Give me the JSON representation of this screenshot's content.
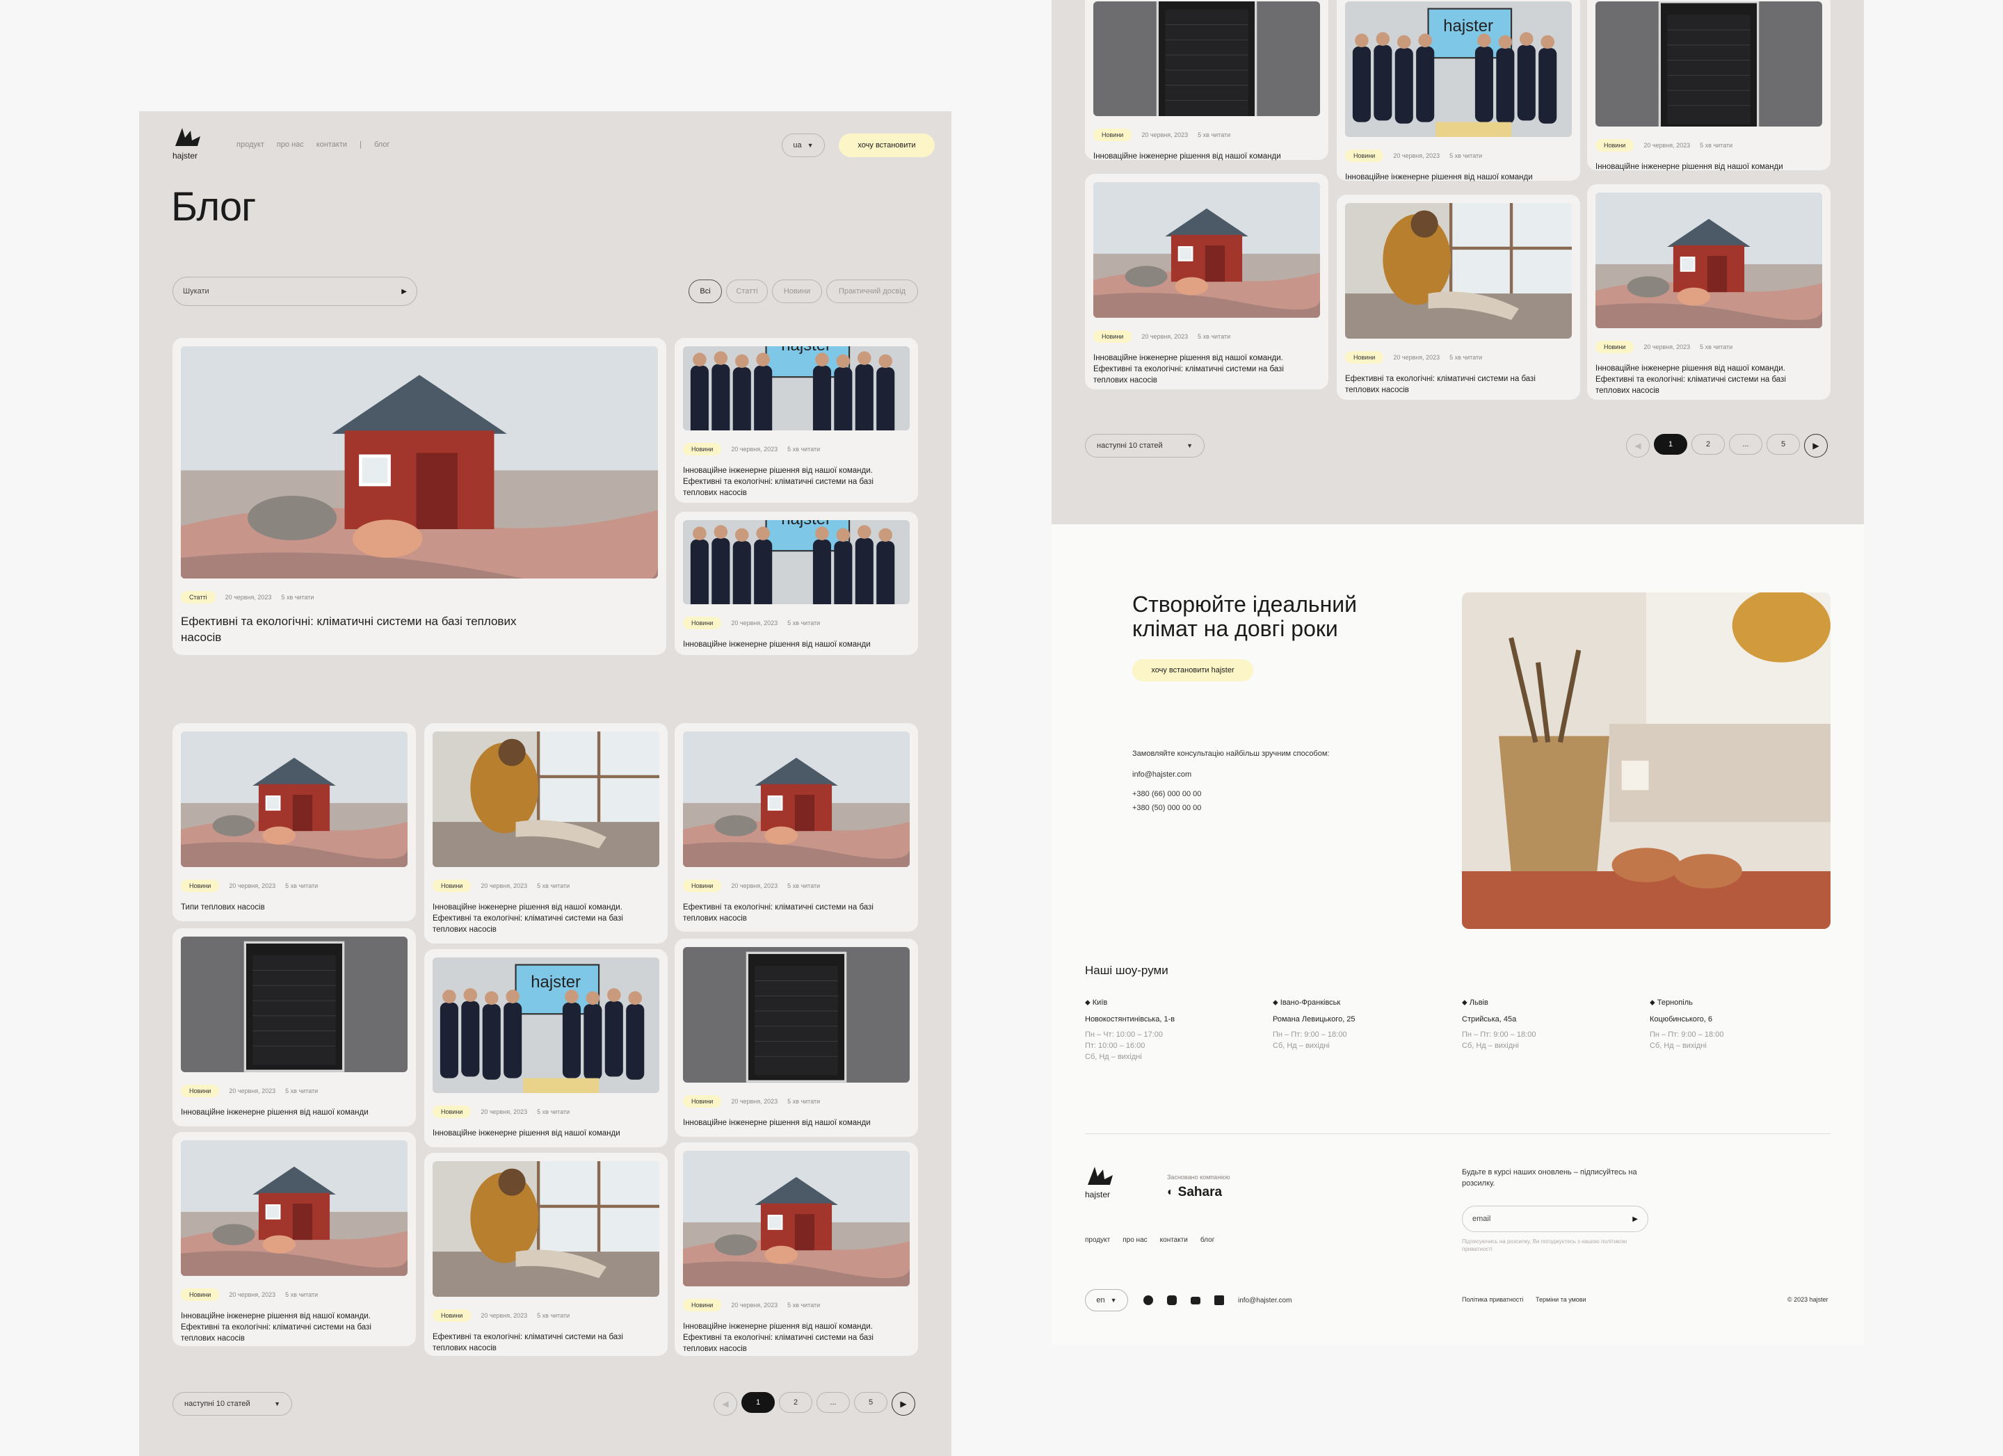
{
  "logo": {
    "text": "hajster"
  },
  "nav": {
    "items": [
      "продукт",
      "про нас",
      "контакти",
      "блог"
    ]
  },
  "header": {
    "lang": "ua",
    "cta": "хочу встановити"
  },
  "page_title": "Блог",
  "search": {
    "placeholder": "Шукати"
  },
  "filters": [
    "Всі",
    "Статті",
    "Новини",
    "Практичний досвід"
  ],
  "featured": {
    "main": {
      "tag": "Статті",
      "date": "20 червня, 2023",
      "read": "5 хв читати",
      "title": "Ефективні та екологічні: кліматичні системи на базі теплових насосів"
    },
    "side1": {
      "tag": "Новини",
      "date": "20 червня, 2023",
      "read": "5 хв читати",
      "title": "Інноваційне інженерне рішення від нашої команди. Ефективні та екологічні: кліматичні системи на базі теплових насосів"
    },
    "side2": {
      "tag": "Новини",
      "date": "20 червня, 2023",
      "read": "5 хв читати",
      "title": "Інноваційне інженерне рішення від нашої команди"
    }
  },
  "grid": [
    {
      "tag": "Новини",
      "date": "20 червня, 2023",
      "read": "5 хв читати",
      "title": "Типи теплових насосів"
    },
    {
      "tag": "Новини",
      "date": "20 червня, 2023",
      "read": "5 хв читати",
      "title": "Інноваційне інженерне рішення від нашої команди. Ефективні та екологічні: кліматичні системи на базі теплових насосів"
    },
    {
      "tag": "Новини",
      "date": "20 червня, 2023",
      "read": "5 хв читати",
      "title": "Ефективні та екологічні: кліматичні системи на базі теплових насосів"
    },
    {
      "tag": "Новини",
      "date": "20 червня, 2023",
      "read": "5 хв читати",
      "title": "Інноваційне інженерне рішення від нашої команди"
    },
    {
      "tag": "Новини",
      "date": "20 червня, 2023",
      "read": "5 хв читати",
      "title": "Інноваційне інженерне рішення від нашої команди"
    },
    {
      "tag": "Новини",
      "date": "20 червня, 2023",
      "read": "5 хв читати",
      "title": "Інноваційне інженерне рішення від нашої команди"
    },
    {
      "tag": "Новини",
      "date": "20 червня, 2023",
      "read": "5 хв читати",
      "title": "Інноваційне інженерне рішення від нашої команди. Ефективні та екологічні: кліматичні системи на базі теплових насосів"
    },
    {
      "tag": "Новини",
      "date": "20 червня, 2023",
      "read": "5 хв читати",
      "title": "Ефективні та екологічні: кліматичні системи на базі теплових насосів"
    },
    {
      "tag": "Новини",
      "date": "20 червня, 2023",
      "read": "5 хв читати",
      "title": "Інноваційне інженерне рішення від нашої команди. Ефективні та екологічні: кліматичні системи на базі теплових насосів"
    }
  ],
  "pagination": {
    "next_label": "наступні 10 статей",
    "pages": [
      "1",
      "2",
      "...",
      "5"
    ]
  },
  "cta_section": {
    "title": "Створюйте ідеальний клімат на довгі роки",
    "button": "хочу встановити hajster",
    "consult": "Замовляйте консультацію найбільш зручним способом:",
    "email": "info@hajster.com",
    "phone1": "+380 (66) 000 00 00",
    "phone2": "+380 (50) 000 00 00"
  },
  "showrooms": {
    "title": "Наші шоу-руми",
    "items": [
      {
        "city": "Київ",
        "address": "Новокостянтинівська, 1-в",
        "hours1": "Пн – Чт: 10:00 – 17:00",
        "hours2": "Пт: 10:00 – 16:00",
        "hours3": "Сб, Нд – вихідні"
      },
      {
        "city": "Івано-Франківськ",
        "address": "Романа Левицького, 25",
        "hours1": "Пн – Пт: 9:00 – 18:00",
        "hours2": "Сб, Нд – вихідні",
        "hours3": ""
      },
      {
        "city": "Львів",
        "address": "Стрийська, 45а",
        "hours1": "Пн – Пт: 9:00 – 18:00",
        "hours2": "Сб, Нд – вихідні",
        "hours3": ""
      },
      {
        "city": "Тернопіль",
        "address": "Коцюбинського, 6",
        "hours1": "Пн – Пт: 9:00 – 18:00",
        "hours2": "Сб, Нд – вихідні",
        "hours3": ""
      }
    ]
  },
  "footer": {
    "founded": "Засновано компанією",
    "sahara": "Sahara",
    "nav": [
      "продукт",
      "про нас",
      "контакти",
      "блог"
    ],
    "subscribe": "Будьте в курсі наших оновлень – підписуйтесь на розсилку.",
    "email_placeholder": "email",
    "consent": "Підписуючись на розсилку, Ви погоджуєтесь з нашою політикою приватності",
    "lang": "en",
    "email": "info@hajster.com",
    "privacy": "Політика приватності",
    "terms": "Терміни та умови",
    "copyright": "© 2023 hajster"
  }
}
